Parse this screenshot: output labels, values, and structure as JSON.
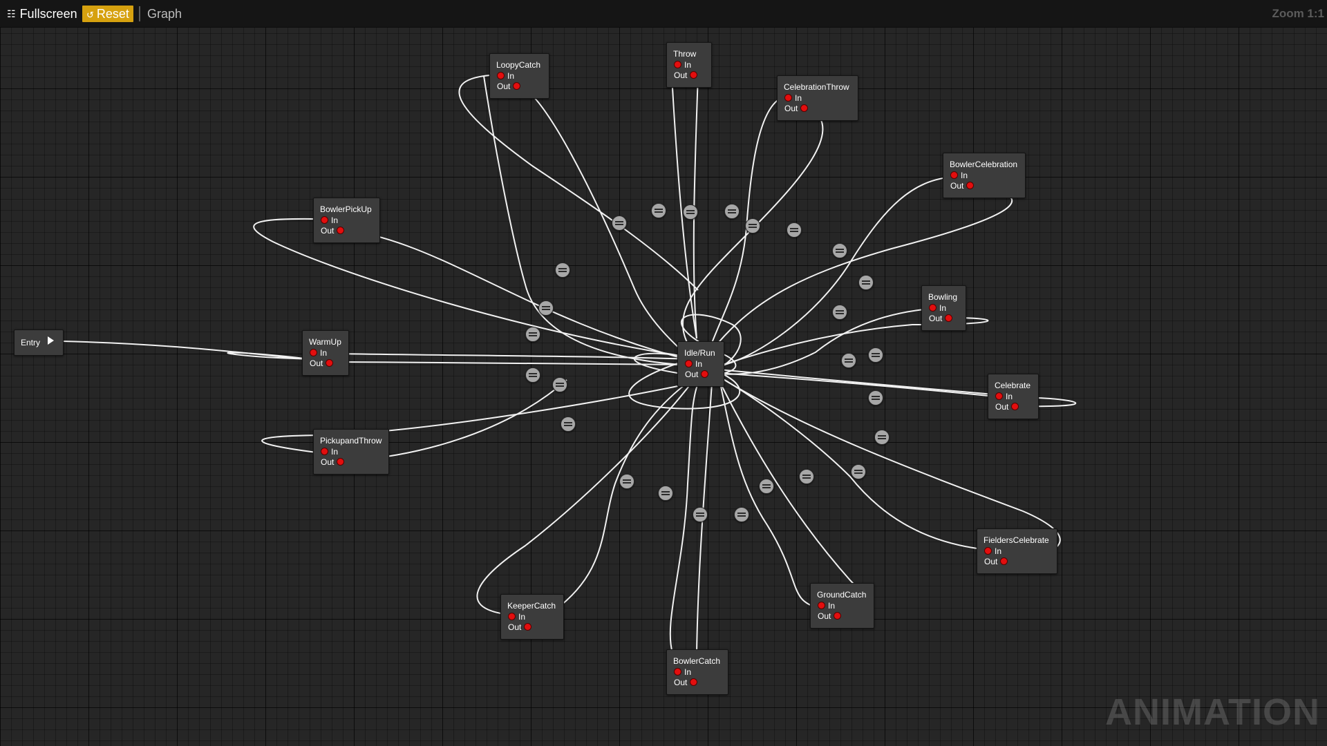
{
  "toolbar": {
    "fullscreen_icon": "fullscreen-icon",
    "fullscreen_label": "Fullscreen",
    "reset_icon": "reset-icon",
    "reset_label": "Reset",
    "graph_label": "Graph",
    "zoom_label": "Zoom 1:1"
  },
  "colors": {
    "accent": "#d6a10f",
    "pin": "#e30e0e",
    "wire": "#f2f2f2",
    "node_bg": "#3c3c3c"
  },
  "graph": {
    "entry_label": "Entry",
    "pin_in_label": "In",
    "pin_out_label": "Out",
    "states": [
      {
        "name": "LoopyCatch"
      },
      {
        "name": "Throw"
      },
      {
        "name": "CelebrationThrow"
      },
      {
        "name": "BowlerCelebration"
      },
      {
        "name": "BowlerPickUp"
      },
      {
        "name": "Bowling"
      },
      {
        "name": "WarmUp"
      },
      {
        "name": "Idle/Run"
      },
      {
        "name": "Celebrate"
      },
      {
        "name": "PickupandThrow"
      },
      {
        "name": "FieldersCelebrate"
      },
      {
        "name": "KeeperCatch"
      },
      {
        "name": "GroundCatch"
      },
      {
        "name": "BowlerCatch"
      }
    ]
  },
  "watermark": "ANIMATION"
}
